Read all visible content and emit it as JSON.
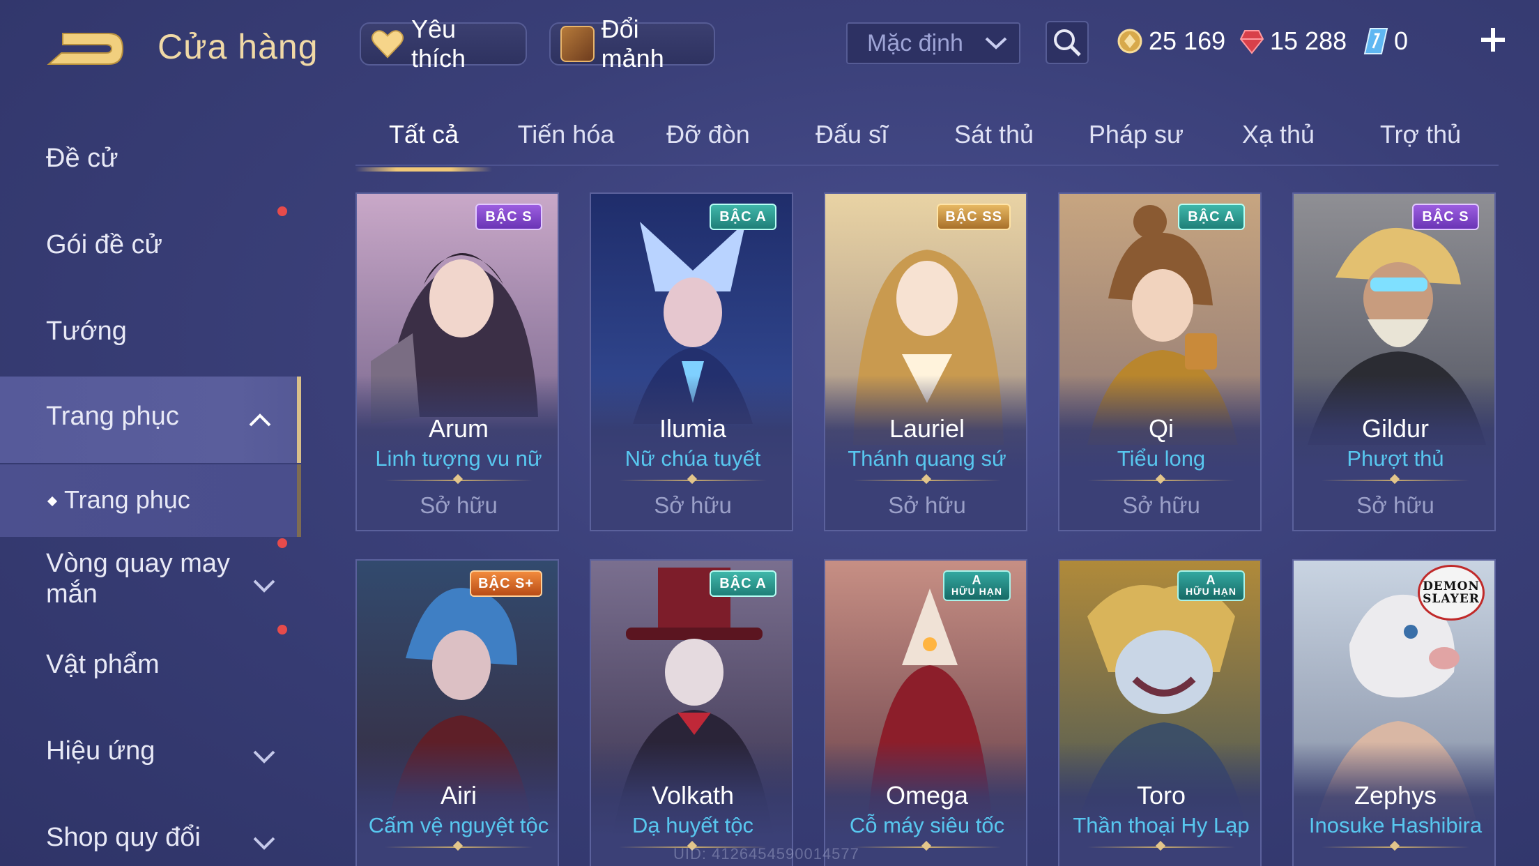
{
  "header": {
    "title": "Cửa hàng",
    "favorites_label": "Yêu thích",
    "exchange_label": "Đổi mảnh",
    "sort": {
      "selected": "Mặc định"
    },
    "currencies": [
      {
        "icon": "gold-coin-icon",
        "value": "25 169"
      },
      {
        "icon": "ruby-gem-icon",
        "value": "15 288"
      },
      {
        "icon": "voucher-icon",
        "value": "0"
      }
    ]
  },
  "sidebar": {
    "items": [
      {
        "label": "Đề cử"
      },
      {
        "label": "Gói đề cử",
        "notify": true
      },
      {
        "label": "Tướng"
      },
      {
        "label": "Trang phục",
        "expanded": true,
        "active": true
      },
      {
        "label": "Trang phục",
        "sub": true,
        "active": true
      },
      {
        "label": "Vòng quay may mắn",
        "notify": true
      },
      {
        "label": "Vật phẩm",
        "notify": true
      },
      {
        "label": "Hiệu ứng"
      },
      {
        "label": "Shop quy đổi"
      }
    ]
  },
  "tabs": [
    "Tất cả",
    "Tiến hóa",
    "Đỡ đòn",
    "Đấu sĩ",
    "Sát thủ",
    "Pháp sư",
    "Xạ thủ",
    "Trợ thủ"
  ],
  "active_tab": "Tất cả",
  "cards": [
    {
      "hero": "Arum",
      "skin": "Linh tượng vu nữ",
      "status": "Sở hữu",
      "badge": "BẬC S"
    },
    {
      "hero": "Ilumia",
      "skin": "Nữ chúa tuyết",
      "status": "Sở hữu",
      "badge": "BẬC A"
    },
    {
      "hero": "Lauriel",
      "skin": "Thánh quang sứ",
      "status": "Sở hữu",
      "badge": "BẬC SS"
    },
    {
      "hero": "Qi",
      "skin": "Tiểu long",
      "status": "Sở hữu",
      "badge": "BẬC A"
    },
    {
      "hero": "Gildur",
      "skin": "Phượt thủ",
      "status": "Sở hữu",
      "badge": "BẬC S"
    },
    {
      "hero": "Airi",
      "skin": "Cấm vệ nguyệt tộc",
      "badge": "BẬC S+"
    },
    {
      "hero": "Volkath",
      "skin": "Dạ huyết tộc",
      "badge": "BẬC A"
    },
    {
      "hero": "Omega",
      "skin": "Cỗ máy siêu tốc",
      "badge": "A",
      "badge_sub": "HỮU HẠN"
    },
    {
      "hero": "Toro",
      "skin": "Thần thoại Hy Lạp",
      "badge": "A",
      "badge_sub": "HỮU HẠN"
    },
    {
      "hero": "Zephys",
      "skin": "Inosuke Hashibira",
      "badge": "DEMON",
      "badge_sub": "SLAYER"
    }
  ],
  "uid_text": "UID: 4126454590014577",
  "colors": {
    "title_gold": "#f0d9a6",
    "skin_blue": "#58c7ef",
    "notify_red": "#e64b4b",
    "active_border": "#d9c08a"
  }
}
